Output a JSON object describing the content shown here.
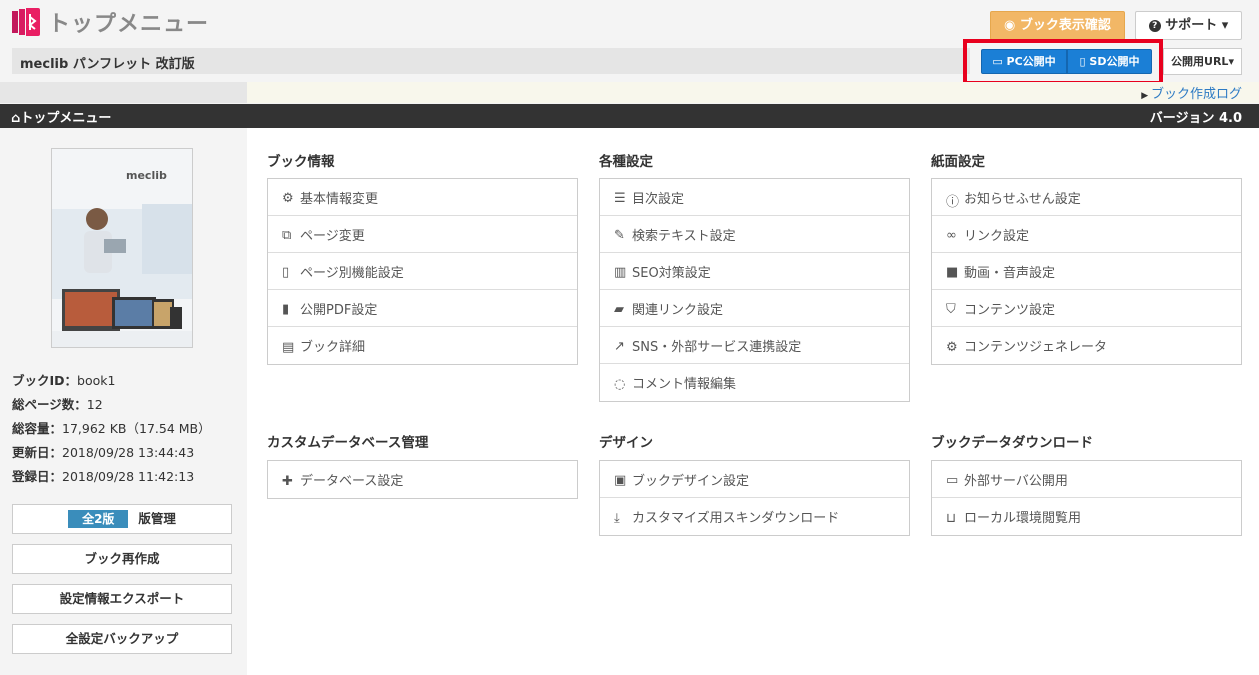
{
  "header": {
    "app_title": "トップメニュー",
    "book_title": "meclib パンフレット 改訂版",
    "preview_label": "ブック表示確認",
    "support_label": "サポート",
    "pc_publish_label": "PC公開中",
    "sd_publish_label": "SD公開中",
    "public_url_label": "公開用URL",
    "log_link": "ブック作成ログ"
  },
  "nav": {
    "left": "トップメニュー",
    "right": "バージョン 4.0"
  },
  "sidebar": {
    "cover_brand": "meclib",
    "info": [
      {
        "label": "ブックID：",
        "value": "book1"
      },
      {
        "label": "総ページ数：",
        "value": "12"
      },
      {
        "label": "総容量：",
        "value": "17,962 KB（17.54 MB）"
      },
      {
        "label": "更新日：",
        "value": "2018/09/28 13:44:43"
      },
      {
        "label": "登録日：",
        "value": "2018/09/28 11:42:13"
      }
    ],
    "version_badge": "全2版",
    "version_label": "版管理",
    "recreate_label": "ブック再作成",
    "export_label": "設定情報エクスポート",
    "backup_label": "全設定バックアップ"
  },
  "sections": {
    "book_info": {
      "title": "ブック情報",
      "items": [
        "基本情報変更",
        "ページ変更",
        "ページ別機能設定",
        "公開PDF設定",
        "ブック詳細"
      ]
    },
    "settings": {
      "title": "各種設定",
      "items": [
        "目次設定",
        "検索テキスト設定",
        "SEO対策設定",
        "関連リンク設定",
        "SNS・外部サービス連携設定",
        "コメント情報編集"
      ]
    },
    "paper": {
      "title": "紙面設定",
      "items": [
        "お知らせふせん設定",
        "リンク設定",
        "動画・音声設定",
        "コンテンツ設定",
        "コンテンツジェネレータ"
      ]
    },
    "custom_db": {
      "title": "カスタムデータベース管理",
      "items": [
        "データベース設定"
      ]
    },
    "design": {
      "title": "デザイン",
      "items": [
        "ブックデザイン設定",
        "カスタマイズ用スキンダウンロード"
      ]
    },
    "download": {
      "title": "ブックデータダウンロード",
      "items": [
        "外部サーバ公開用",
        "ローカル環境閲覧用"
      ]
    }
  },
  "colors": {
    "accent_orange": "#f2b766",
    "publish_blue": "#1b7fd6",
    "highlight_red": "#e8001e",
    "nav_dark": "#333333",
    "link_blue": "#2e7bc4"
  }
}
